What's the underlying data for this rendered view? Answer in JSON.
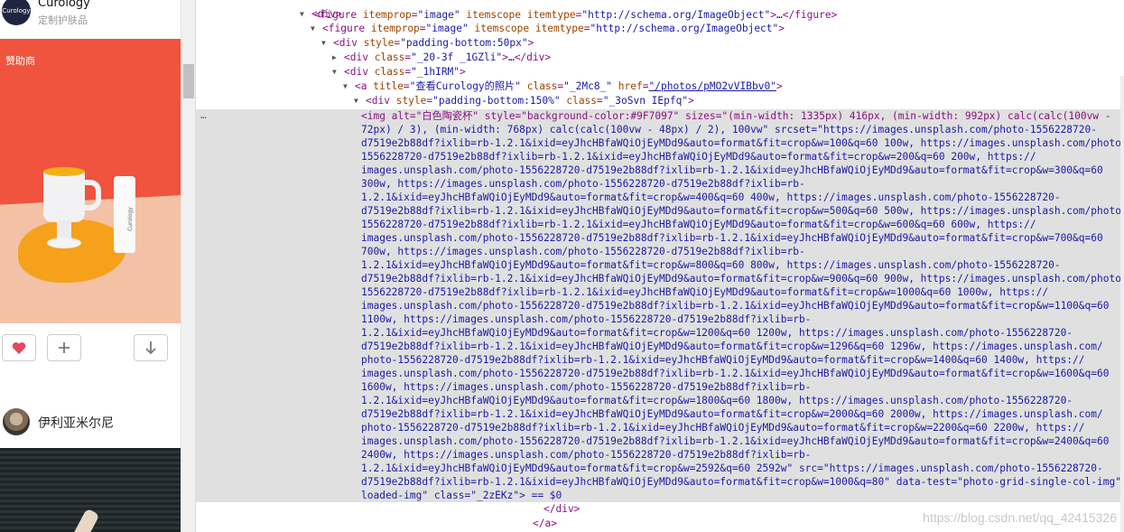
{
  "left_panel": {
    "brand": {
      "logo_text": "Curology",
      "name": "Curology",
      "subtitle": "定制护肤品"
    },
    "sponsor_label": "赞助商",
    "tube_text": "Curology",
    "actions": {
      "like_icon": "heart-icon",
      "add_icon": "plus-icon",
      "download_icon": "arrow-down-icon"
    },
    "user_name": "伊利亚米尔尼"
  },
  "devtools": {
    "lines": [
      {
        "indent": 0,
        "raw": "<figure itemprop=\"image\" itemscope itemtype=\"http://schema.org/ImageObject\">…</figure>"
      },
      {
        "tag": "div"
      },
      {
        "tag": "figure",
        "attrs": [
          [
            "itemprop",
            "image"
          ],
          [
            "itemscope",
            ""
          ],
          [
            "itemtype",
            "http://schema.org/ImageObject"
          ]
        ]
      },
      {
        "tag": "div",
        "attrs": [
          [
            "style",
            "padding-bottom:50px"
          ]
        ]
      },
      {
        "tag": "div",
        "attrs": [
          [
            "class",
            "_20-3f _1GZli"
          ]
        ],
        "collapsed": true
      },
      {
        "tag": "div",
        "attrs": [
          [
            "class",
            "_1hIRM"
          ]
        ]
      },
      {
        "tag": "a",
        "attrs": [
          [
            "title",
            "查看Curology的照片"
          ],
          [
            "class",
            "_2Mc8_"
          ],
          [
            "href",
            "/photos/pMO2vVIBbv0"
          ]
        ]
      },
      {
        "tag": "div",
        "attrs": [
          [
            "style",
            "padding-bottom:150%"
          ],
          [
            "class",
            "_3oSvn IEpfq"
          ]
        ]
      }
    ],
    "img_block": [
      "<img alt=\"白色陶瓷杯\" style=\"background-color:#9F7097\" sizes=\"(min-width: 1335px) 416px, (min-width: 992px) calc(calc(100vw -",
      "72px) / 3), (min-width: 768px) calc(calc(100vw - 48px) / 2), 100vw\" srcset=\"https://images.unsplash.com/photo-1556228720-",
      "d7519e2b88df?ixlib=rb-1.2.1&ixid=eyJhcHBfaWQiOjEyMDd9&auto=format&fit=crop&w=100&q=60 100w, https://images.unsplash.com/photo-",
      "1556228720-d7519e2b88df?ixlib=rb-1.2.1&ixid=eyJhcHBfaWQiOjEyMDd9&auto=format&fit=crop&w=200&q=60 200w, https://",
      "images.unsplash.com/photo-1556228720-d7519e2b88df?ixlib=rb-1.2.1&ixid=eyJhcHBfaWQiOjEyMDd9&auto=format&fit=crop&w=300&q=60",
      "300w, https://images.unsplash.com/photo-1556228720-d7519e2b88df?ixlib=rb-",
      "1.2.1&ixid=eyJhcHBfaWQiOjEyMDd9&auto=format&fit=crop&w=400&q=60 400w, https://images.unsplash.com/photo-1556228720-",
      "d7519e2b88df?ixlib=rb-1.2.1&ixid=eyJhcHBfaWQiOjEyMDd9&auto=format&fit=crop&w=500&q=60 500w, https://images.unsplash.com/photo-",
      "1556228720-d7519e2b88df?ixlib=rb-1.2.1&ixid=eyJhcHBfaWQiOjEyMDd9&auto=format&fit=crop&w=600&q=60 600w, https://",
      "images.unsplash.com/photo-1556228720-d7519e2b88df?ixlib=rb-1.2.1&ixid=eyJhcHBfaWQiOjEyMDd9&auto=format&fit=crop&w=700&q=60",
      "700w, https://images.unsplash.com/photo-1556228720-d7519e2b88df?ixlib=rb-",
      "1.2.1&ixid=eyJhcHBfaWQiOjEyMDd9&auto=format&fit=crop&w=800&q=60 800w, https://images.unsplash.com/photo-1556228720-",
      "d7519e2b88df?ixlib=rb-1.2.1&ixid=eyJhcHBfaWQiOjEyMDd9&auto=format&fit=crop&w=900&q=60 900w, https://images.unsplash.com/photo-",
      "1556228720-d7519e2b88df?ixlib=rb-1.2.1&ixid=eyJhcHBfaWQiOjEyMDd9&auto=format&fit=crop&w=1000&q=60 1000w, https://",
      "images.unsplash.com/photo-1556228720-d7519e2b88df?ixlib=rb-1.2.1&ixid=eyJhcHBfaWQiOjEyMDd9&auto=format&fit=crop&w=1100&q=60",
      "1100w, https://images.unsplash.com/photo-1556228720-d7519e2b88df?ixlib=rb-",
      "1.2.1&ixid=eyJhcHBfaWQiOjEyMDd9&auto=format&fit=crop&w=1200&q=60 1200w, https://images.unsplash.com/photo-1556228720-",
      "d7519e2b88df?ixlib=rb-1.2.1&ixid=eyJhcHBfaWQiOjEyMDd9&auto=format&fit=crop&w=1296&q=60 1296w, https://images.unsplash.com/",
      "photo-1556228720-d7519e2b88df?ixlib=rb-1.2.1&ixid=eyJhcHBfaWQiOjEyMDd9&auto=format&fit=crop&w=1400&q=60 1400w, https://",
      "images.unsplash.com/photo-1556228720-d7519e2b88df?ixlib=rb-1.2.1&ixid=eyJhcHBfaWQiOjEyMDd9&auto=format&fit=crop&w=1600&q=60",
      "1600w, https://images.unsplash.com/photo-1556228720-d7519e2b88df?ixlib=rb-",
      "1.2.1&ixid=eyJhcHBfaWQiOjEyMDd9&auto=format&fit=crop&w=1800&q=60 1800w, https://images.unsplash.com/photo-1556228720-",
      "d7519e2b88df?ixlib=rb-1.2.1&ixid=eyJhcHBfaWQiOjEyMDd9&auto=format&fit=crop&w=2000&q=60 2000w, https://images.unsplash.com/",
      "photo-1556228720-d7519e2b88df?ixlib=rb-1.2.1&ixid=eyJhcHBfaWQiOjEyMDd9&auto=format&fit=crop&w=2200&q=60 2200w, https://",
      "images.unsplash.com/photo-1556228720-d7519e2b88df?ixlib=rb-1.2.1&ixid=eyJhcHBfaWQiOjEyMDd9&auto=format&fit=crop&w=2400&q=60",
      "2400w, https://images.unsplash.com/photo-1556228720-d7519e2b88df?ixlib=rb-",
      "1.2.1&ixid=eyJhcHBfaWQiOjEyMDd9&auto=format&fit=crop&w=2592&q=60 2592w\" src=\"https://images.unsplash.com/photo-1556228720-",
      "d7519e2b88df?ixlib=rb-1.2.1&ixid=eyJhcHBfaWQiOjEyMDd9&auto=format&fit=crop&w=1000&q=80\" data-test=\"photo-grid-single-col-img\" data-perf=\"eager-",
      "loaded-img\" class=\"_2zEKz\"> == $0"
    ],
    "closing": [
      "</div>",
      "</a>"
    ],
    "dots": "…"
  },
  "watermark": "https://blog.csdn.net/qq_42415326",
  "colors": {
    "tag": "#881280",
    "attr_name": "#994500",
    "attr_value": "#1a1aa6",
    "selection": "#e0e0e0"
  }
}
